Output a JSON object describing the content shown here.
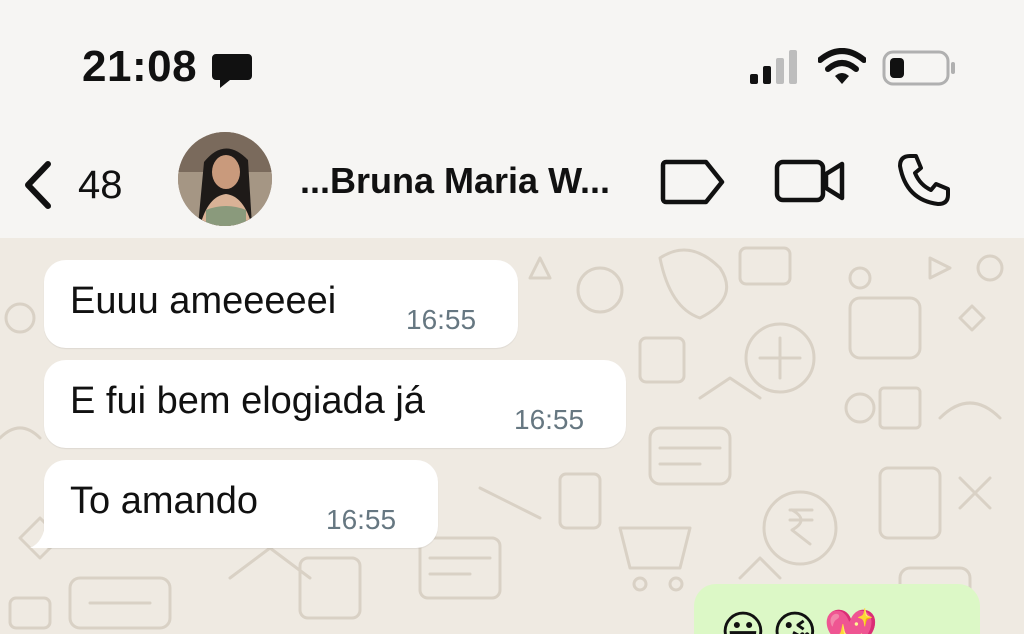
{
  "status_bar": {
    "time": "21:08",
    "icons": [
      "message-notification-icon",
      "signal-icon",
      "wifi-icon",
      "battery-icon"
    ]
  },
  "header": {
    "back_count": "48",
    "contact_name": "...Bruna Maria W...",
    "actions": [
      "label-icon",
      "video-call-icon",
      "voice-call-icon"
    ]
  },
  "messages": [
    {
      "direction": "incoming",
      "text": "Euuu ameeeeei",
      "time": "16:55"
    },
    {
      "direction": "incoming",
      "text": "E fui bem elogiada já",
      "time": "16:55"
    },
    {
      "direction": "incoming",
      "text": "To amando",
      "time": "16:55"
    }
  ],
  "outgoing_partial": {
    "emojis": "😀😘💖"
  },
  "colors": {
    "header_bg": "#f6f5f3",
    "chat_bg": "#efeae2",
    "incoming_bubble": "#ffffff",
    "outgoing_bubble": "#dcf8c6",
    "timestamp": "#667781"
  }
}
